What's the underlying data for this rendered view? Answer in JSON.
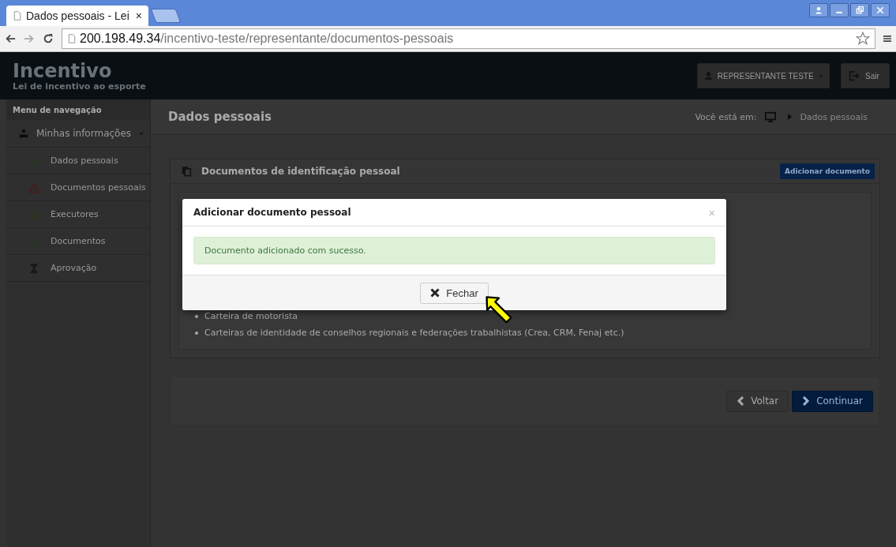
{
  "browser": {
    "tab_title": "Dados pessoais - Lei",
    "tab_close": "×",
    "url_host": "200.198.49.34",
    "url_path": "/incentivo-teste/representante/documentos-pessoais"
  },
  "header": {
    "title": "Incentivo",
    "subtitle": "Lei de incentivo ao esporte",
    "user_button": "REPRESENTANTE TESTE",
    "logout_button": "Sair"
  },
  "sidebar": {
    "heading": "Menu de navegação",
    "section": {
      "label": "Minhas informações",
      "expanded": true,
      "items": [
        {
          "label": "Dados pessoais",
          "kind": "done"
        },
        {
          "label": "Documentos pessoais",
          "kind": "warning"
        },
        {
          "label": "Executores",
          "kind": "done"
        },
        {
          "label": "Documentos",
          "kind": "done"
        },
        {
          "label": "Aprovação",
          "kind": "pending"
        }
      ]
    }
  },
  "page": {
    "title": "Dados pessoais",
    "breadcrumb_label": "Você está em:",
    "breadcrumb_current": "Dados pessoais"
  },
  "card": {
    "title": "Documentos de identificação pessoal",
    "add_button": "Adicionar documento",
    "list_items": [
      "Carteira de motorista",
      "Carteiras de identidade de conselhos regionais e federações trabalhistas (Crea, CRM, Fenaj etc.)"
    ]
  },
  "nav_buttons": {
    "back": "Voltar",
    "next": "Continuar"
  },
  "modal": {
    "title": "Adicionar documento pessoal",
    "close": "×",
    "message": "Documento adicionado com sucesso.",
    "button": "Fechar"
  }
}
